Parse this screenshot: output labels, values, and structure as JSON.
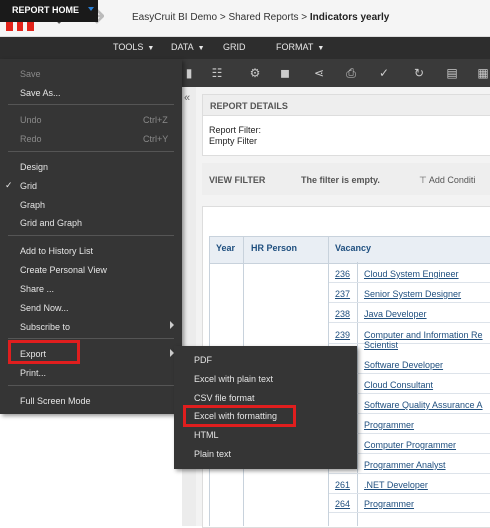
{
  "breadcrumb": {
    "app": "EasyCruit BI Demo",
    "sep1": ">",
    "folder": "Shared Reports",
    "sep2": ">",
    "report": "Indicators yearly"
  },
  "menubar": {
    "home": "REPORT HOME",
    "tools": "TOOLS",
    "data": "DATA",
    "grid": "GRID",
    "format": "FORMAT"
  },
  "menu": {
    "save": "Save",
    "save_as": "Save As...",
    "undo": "Undo",
    "undo_sc": "Ctrl+Z",
    "redo": "Redo",
    "redo_sc": "Ctrl+Y",
    "design": "Design",
    "grid": "Grid",
    "check": "✓",
    "graph": "Graph",
    "grid_graph": "Grid and Graph",
    "add_history": "Add to History List",
    "personal_view": "Create Personal View",
    "share": "Share ...",
    "send_now": "Send Now...",
    "subscribe": "Subscribe to",
    "export": "Export",
    "print": "Print...",
    "fullscreen": "Full Screen Mode"
  },
  "submenu": {
    "pdf": "PDF",
    "excel_plain": "Excel with plain text",
    "csv": "CSV file format",
    "excel_fmt": "Excel with formatting",
    "html": "HTML",
    "plain": "Plain text"
  },
  "details": {
    "header": "REPORT DETAILS",
    "report_filter": "Report Filter:",
    "empty_filter": "Empty Filter"
  },
  "view_filter": {
    "label": "VIEW FILTER",
    "empty": "The filter is empty.",
    "add": "Add Conditi"
  },
  "grid": {
    "headers": {
      "year": "Year",
      "person": "HR Person",
      "vacancy": "Vacancy"
    },
    "rows": [
      {
        "id": "236",
        "title": "Cloud System Engineer"
      },
      {
        "id": "237",
        "title": "Senior System Designer"
      },
      {
        "id": "238",
        "title": "Java Developer"
      },
      {
        "id": "239",
        "title": "Computer and Information Re",
        "title2": "Scientist"
      },
      {
        "id": "",
        "title": "Software Developer"
      },
      {
        "id": "",
        "title": "Cloud Consultant"
      },
      {
        "id": "",
        "title": "Software Quality Assurance A"
      },
      {
        "id": "",
        "title": "Programmer"
      },
      {
        "id": "",
        "title": "Computer Programmer"
      },
      {
        "id": "",
        "title": "Programmer Analyst"
      },
      {
        "id": "261",
        "title": ".NET Developer"
      },
      {
        "id": "264",
        "title": "Programmer"
      }
    ]
  },
  "colors": {
    "accent_red": "#e01e1e",
    "menu_bg": "#353535",
    "link": "#1f4f7f"
  }
}
